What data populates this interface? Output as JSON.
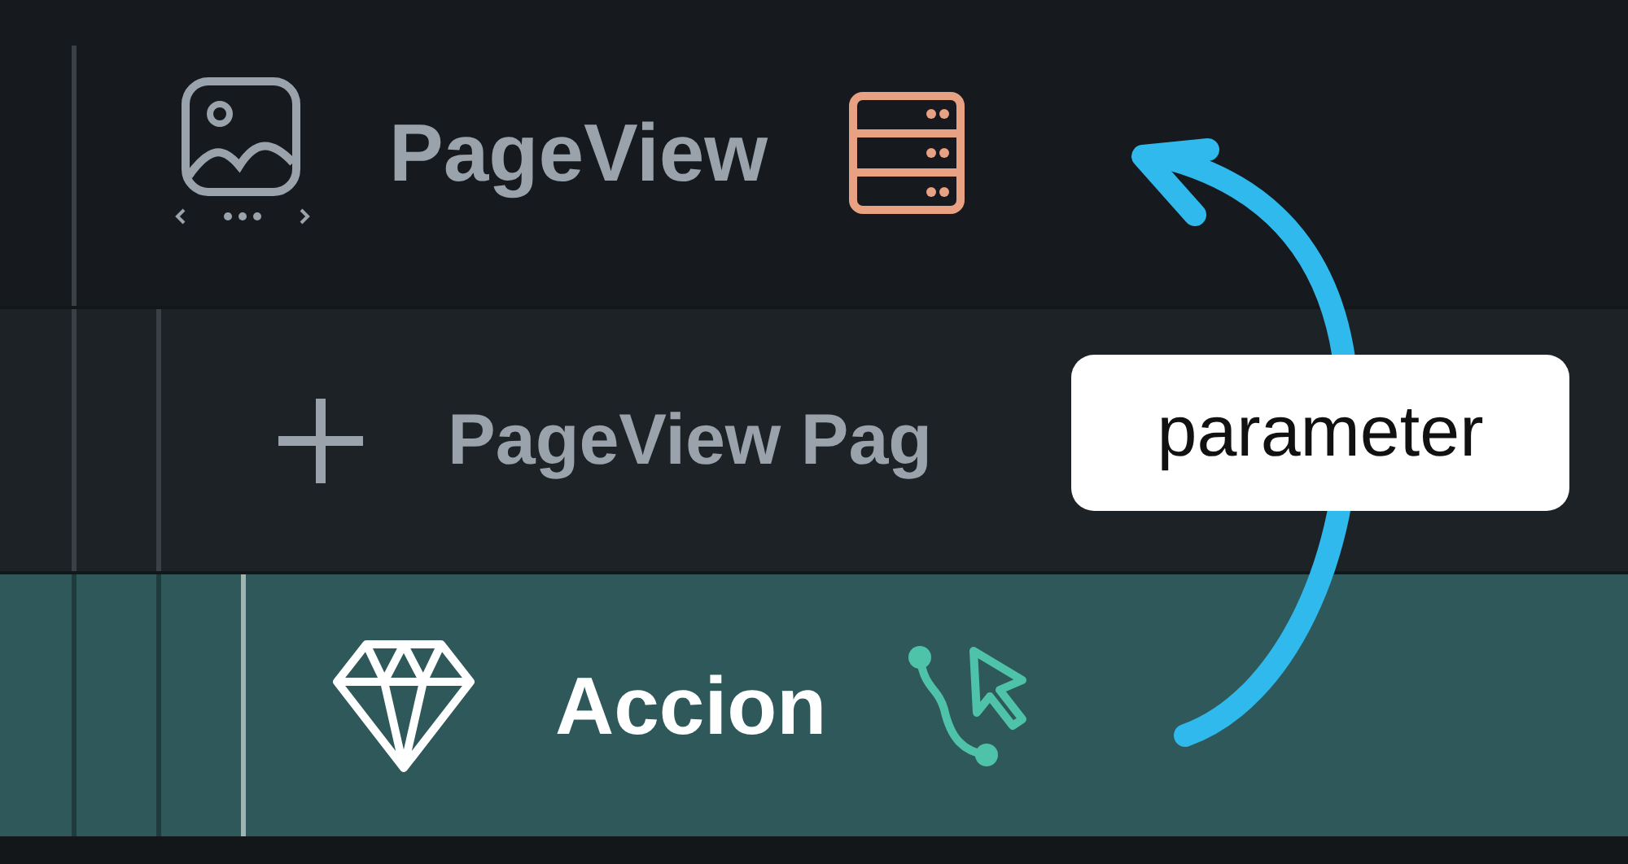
{
  "tree": [
    {
      "label": "PageView",
      "kind": "page-view",
      "badge": {
        "kind": "database"
      },
      "selected": false,
      "children": [
        {
          "label": "PageView Pag",
          "kind": "add",
          "selected": false,
          "children": [
            {
              "label": "Accion",
              "kind": "component",
              "badge": {
                "kind": "action"
              },
              "selected": true
            }
          ]
        }
      ]
    }
  ],
  "annotation": {
    "callout": "parameter"
  }
}
